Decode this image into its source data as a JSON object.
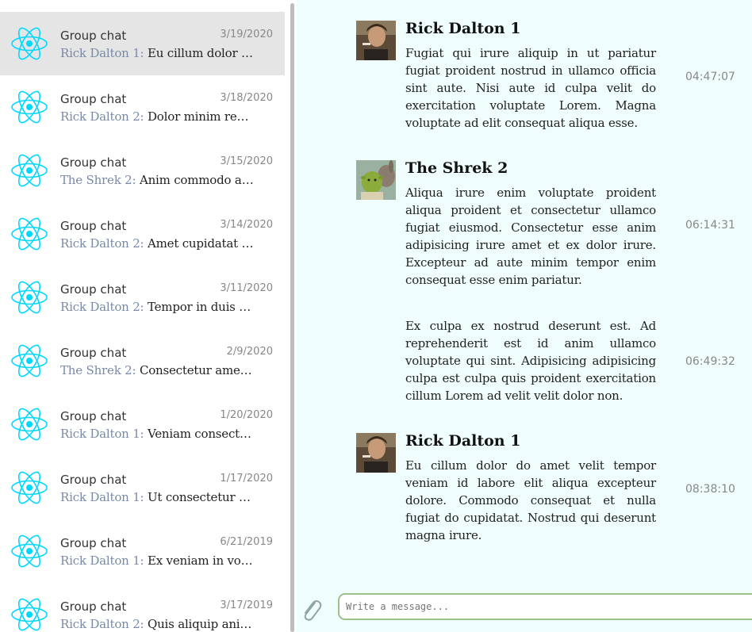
{
  "conversations": [
    {
      "title": "Group chat",
      "date": "3/19/2020",
      "sender": "Rick Dalton 1:",
      "preview": "Eu cillum dolor do..."
    },
    {
      "title": "Group chat",
      "date": "3/18/2020",
      "sender": "Rick Dalton 2:",
      "preview": "Dolor minim repreh..."
    },
    {
      "title": "Group chat",
      "date": "3/15/2020",
      "sender": "The Shrek 2:",
      "preview": "Anim commodo aliqu..."
    },
    {
      "title": "Group chat",
      "date": "3/14/2020",
      "sender": "Rick Dalton 2:",
      "preview": "Amet cupidatat non..."
    },
    {
      "title": "Group chat",
      "date": "3/11/2020",
      "sender": "Rick Dalton 2:",
      "preview": "Tempor in duis adi..."
    },
    {
      "title": "Group chat",
      "date": "2/9/2020",
      "sender": "The Shrek 2:",
      "preview": "Consectetur amet i..."
    },
    {
      "title": "Group chat",
      "date": "1/20/2020",
      "sender": "Rick Dalton 1:",
      "preview": "Veniam consectetur..."
    },
    {
      "title": "Group chat",
      "date": "1/17/2020",
      "sender": "Rick Dalton 1:",
      "preview": "Ut consectetur nos..."
    },
    {
      "title": "Group chat",
      "date": "6/21/2019",
      "sender": "Rick Dalton 1:",
      "preview": "Ex veniam in volup..."
    },
    {
      "title": "Group chat",
      "date": "3/17/2019",
      "sender": "Rick Dalton 2:",
      "preview": "Quis aliquip anim..."
    }
  ],
  "messages": [
    {
      "author": "Rick Dalton 1",
      "text": "Fugiat qui irure aliquip in ut pariatur fugiat proident nostrud in ullamco officia sint aute. Nisi aute id culpa velit do exercitation voluptate Lorem. Magna voluptate ad elit consequat aliqua esse.",
      "time": "04:47:07"
    },
    {
      "author": "The Shrek 2",
      "text": "Aliqua irure enim voluptate proident aliqua proident et consectetur ullamco fugiat eiusmod. Consectetur esse anim adipisicing irure amet et ex dolor irure. Excepteur ad aute minim tempor enim consequat esse enim pariatur.",
      "time": "06:14:31"
    },
    {
      "author": "",
      "text": "Ex culpa ex nostrud deserunt est. Ad reprehenderit est id anim ullamco voluptate qui sint. Adipisicing adipisicing culpa est culpa quis proident exercitation cillum Lorem ad velit velit dolor non.",
      "time": "06:49:32"
    },
    {
      "author": "Rick Dalton 1",
      "text": "Eu cillum dolor do amet velit tempor veniam id labore elit aliqua excepteur dolore. Commodo consequat et nulla fugiat do cupidatat. Nostrud qui deserunt magna irure.",
      "time": "08:38:10"
    }
  ],
  "composer": {
    "placeholder": "Write a message..."
  },
  "colors": {
    "chat_bg": "#effdfd",
    "active_item": "#e5e5e5",
    "react_icon": "#00d8ff",
    "input_border": "#9fc08a",
    "sender": "#7a8aa6"
  }
}
